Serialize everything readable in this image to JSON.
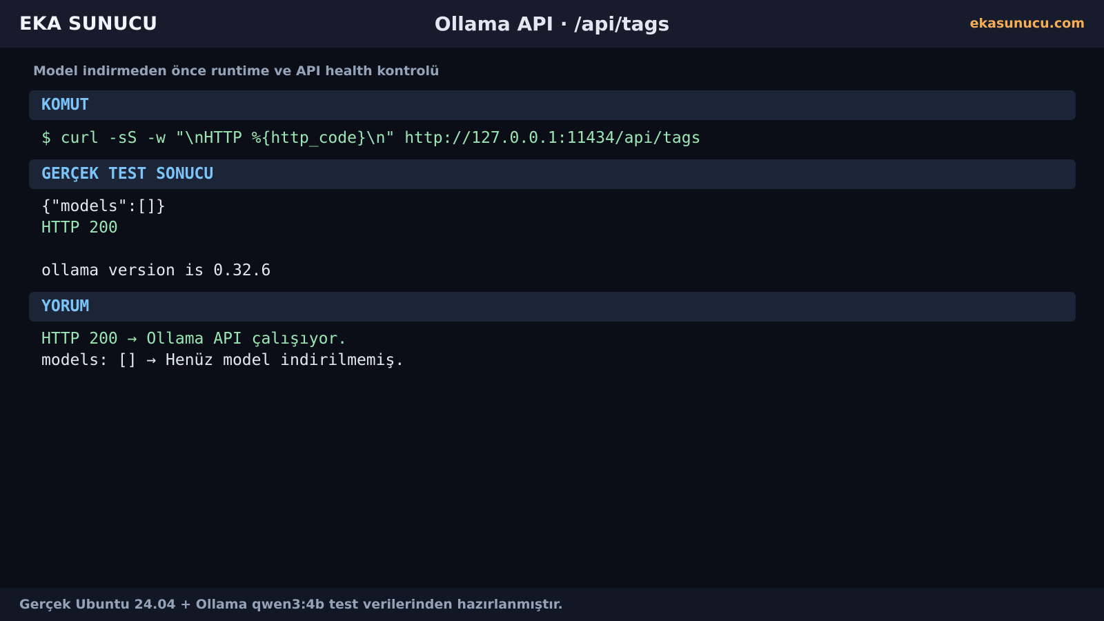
{
  "header": {
    "brand": "EKA SUNUCU",
    "title": "Ollama API · /api/tags",
    "site": "ekasunucu.com"
  },
  "subtitle": "Model indirmeden önce runtime ve API health kontrolü",
  "sections": {
    "command": {
      "heading": "KOMUT",
      "line": "$ curl -sS -w \"\\nHTTP %{http_code}\\n\" http://127.0.0.1:11434/api/tags"
    },
    "result": {
      "heading": "GERÇEK TEST SONUCU",
      "json_line": "{\"models\":[]}",
      "status_line": "HTTP 200",
      "version_line": "ollama version is 0.32.6"
    },
    "comment": {
      "heading": "YORUM",
      "line1": "HTTP 200 → Ollama API çalışıyor.",
      "line2": "models: [] → Henüz model indirilmemiş."
    }
  },
  "footer": {
    "text": "Gerçek Ubuntu 24.04 + Ollama qwen3:4b test verilerinden hazırlanmıştır."
  },
  "colors": {
    "background": "#0b0e17",
    "header_bg": "#161c2c",
    "section_bg": "#1c2538",
    "heading_blue": "#7cc4f8",
    "accent_orange": "#f6ad55",
    "output_green": "#9ae6b4"
  }
}
